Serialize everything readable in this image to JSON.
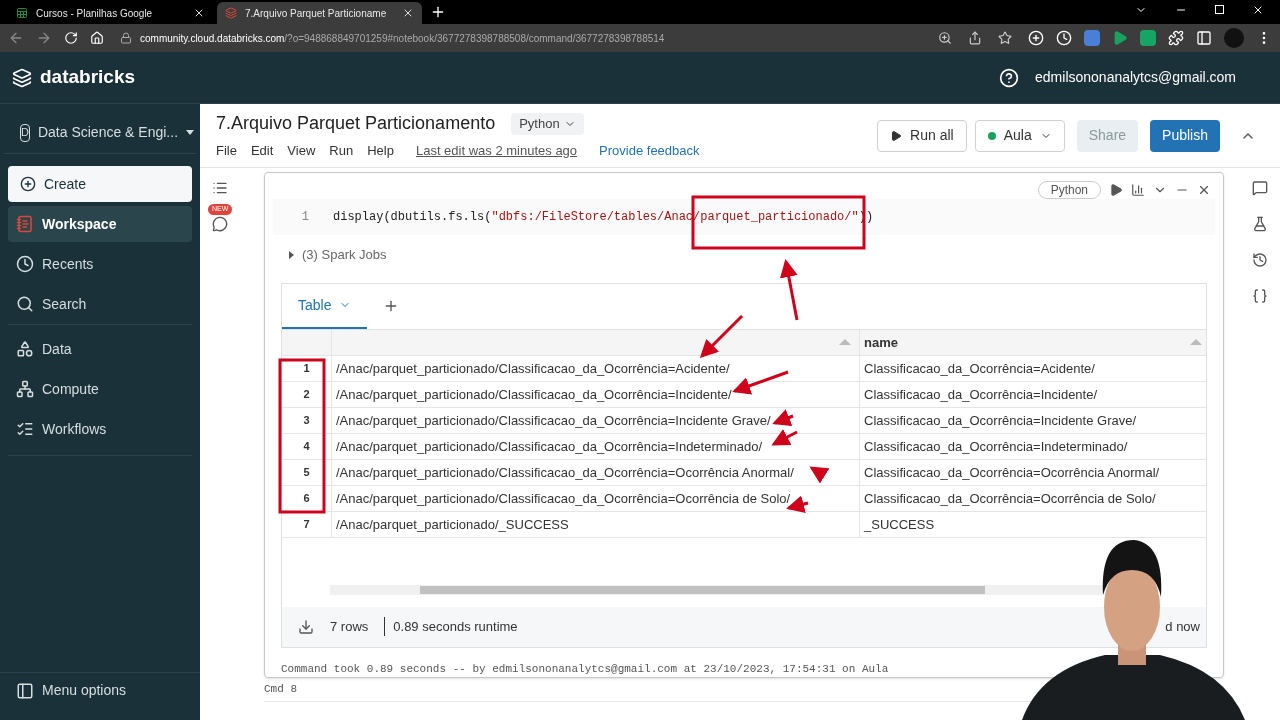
{
  "browser": {
    "tabs": [
      {
        "title": "Cursos - Planilhas Google",
        "selected": false
      },
      {
        "title": "7.Arquivo Parquet Particioname",
        "selected": true
      }
    ],
    "url_host": "community.cloud.databricks.com",
    "url_rest": "/?o=948868849701259#notebook/3677278398788508/command/3677278398788514"
  },
  "header": {
    "brand": "databricks",
    "user_email": "edmilsononanalytcs@gmail.com"
  },
  "sidebar": {
    "workspace_letter": "D",
    "workspace": "Data Science & Engi...",
    "create": "Create",
    "items": [
      {
        "label": "Workspace",
        "selected": true
      },
      {
        "label": "Recents",
        "selected": false
      },
      {
        "label": "Search",
        "selected": false
      },
      {
        "label": "Data",
        "selected": false
      },
      {
        "label": "Compute",
        "selected": false
      },
      {
        "label": "Workflows",
        "selected": false
      }
    ],
    "menu_options": "Menu options"
  },
  "notebook": {
    "title": "7.Arquivo Parquet Particionamento",
    "language": "Python",
    "menu": [
      "File",
      "Edit",
      "View",
      "Run",
      "Help"
    ],
    "last_edit": "Last edit was 2 minutes ago",
    "feedback": "Provide feedback",
    "run_all": "Run all",
    "cluster": {
      "name": "Aula",
      "running": true
    },
    "share": {
      "label": "Share",
      "disabled": true
    },
    "publish": "Publish",
    "new_badge": "NEW"
  },
  "cell": {
    "language_badge": "Python",
    "line_number": "1",
    "code": [
      {
        "text": "display(dbutils.fs.ls(",
        "kind": "plain"
      },
      {
        "text": "\"dbfs:/FileStore/tables/Anac/parquet_particionado/\"",
        "kind": "string"
      },
      {
        "text": "))",
        "kind": "plain"
      }
    ],
    "spark_jobs": "(3) Spark Jobs",
    "result_tabs": [
      {
        "label": "Table",
        "selected": true
      }
    ],
    "column_2_header": "name",
    "rows": [
      {
        "index": "1",
        "path": "/Anac/parquet_particionado/Classificacao_da_Ocorrência=Acidente/",
        "name": "Classificacao_da_Ocorrência=Acidente/"
      },
      {
        "index": "2",
        "path": "/Anac/parquet_particionado/Classificacao_da_Ocorrência=Incidente/",
        "name": "Classificacao_da_Ocorrência=Incidente/"
      },
      {
        "index": "3",
        "path": "/Anac/parquet_particionado/Classificacao_da_Ocorrência=Incidente Grave/",
        "name": "Classificacao_da_Ocorrência=Incidente Grave/"
      },
      {
        "index": "4",
        "path": "/Anac/parquet_particionado/Classificacao_da_Ocorrência=Indeterminado/",
        "name": "Classificacao_da_Ocorrência=Indeterminado/"
      },
      {
        "index": "5",
        "path": "/Anac/parquet_particionado/Classificacao_da_Ocorrência=Ocorrência Anormal/",
        "name": "Classificacao_da_Ocorrência=Ocorrência Anormal/"
      },
      {
        "index": "6",
        "path": "/Anac/parquet_particionado/Classificacao_da_Ocorrência=Ocorrência de Solo/",
        "name": "Classificacao_da_Ocorrência=Ocorrência de Solo/"
      },
      {
        "index": "7",
        "path": "/Anac/parquet_particionado/_SUCCESS",
        "name": "_SUCCESS"
      }
    ],
    "rows_count": "7 rows",
    "runtime": "0.89 seconds runtime",
    "refreshed_partial": "d now",
    "command_info": "Command took 0.89 seconds -- by edmilsononanalytcs@gmail.com at 23/10/2023, 17:54:31 on Aula"
  },
  "next_cell": "Cmd 8"
}
